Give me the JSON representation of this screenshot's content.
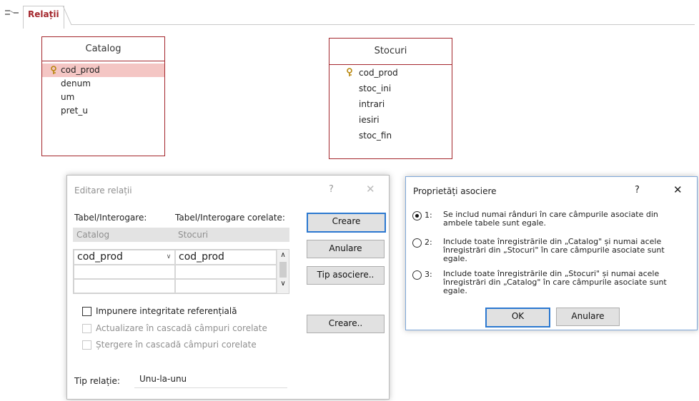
{
  "tab": {
    "label": "Relații",
    "icon": "relationships-icon"
  },
  "catalog_table": {
    "title": "Catalog",
    "fields": [
      "cod_prod",
      "denum",
      "um",
      "pret_u"
    ],
    "key_field": "cod_prod"
  },
  "stocuri_table": {
    "title": "Stocuri",
    "fields": [
      "cod_prod",
      "stoc_ini",
      "intrari",
      "iesiri",
      "stoc_fin"
    ],
    "key_field": "cod_prod"
  },
  "edit_dialog": {
    "title": "Editare relații",
    "help": "?",
    "close": "✕",
    "col_left_header": "Tabel/Interogare:",
    "col_right_header": "Tabel/Interogare corelate:",
    "left_table": "Catalog",
    "right_table": "Stocuri",
    "row1_left": "cod_prod",
    "row1_right": "cod_prod",
    "create_btn": "Creare",
    "cancel_btn": "Anulare",
    "join_type_btn": "Tip asociere..",
    "create_new_btn": "Creare..",
    "enforce_label": "Impunere integritate referențială",
    "cascade_update_label": "Actualizare în cascadă câmpuri corelate",
    "cascade_delete_label": "Ștergere în cascadă câmpuri corelate",
    "rel_type_label": "Tip relație:",
    "rel_type_value": "Unu-la-unu"
  },
  "join_dialog": {
    "title": "Proprietăți asociere",
    "help": "?",
    "close": "✕",
    "opt1_num": "1:",
    "opt1_text": "Se includ numai rânduri în care câmpurile asociate din ambele tabele sunt egale.",
    "opt2_num": "2:",
    "opt2_text": "Include toate înregistrările din „Catalog\" și numai acele înregistrări din „Stocuri\" în care câmpurile asociate sunt egale.",
    "opt3_num": "3:",
    "opt3_text": "Include toate înregistrările din „Stocuri\" și numai acele înregistrări din „Catalog\" în care câmpurile asociate sunt egale.",
    "selected_option": 1,
    "ok_btn": "OK",
    "cancel_btn": "Anulare"
  },
  "colors": {
    "accent": "#a4262c",
    "selection": "#f4c6c4",
    "focus": "#2b78d0"
  }
}
